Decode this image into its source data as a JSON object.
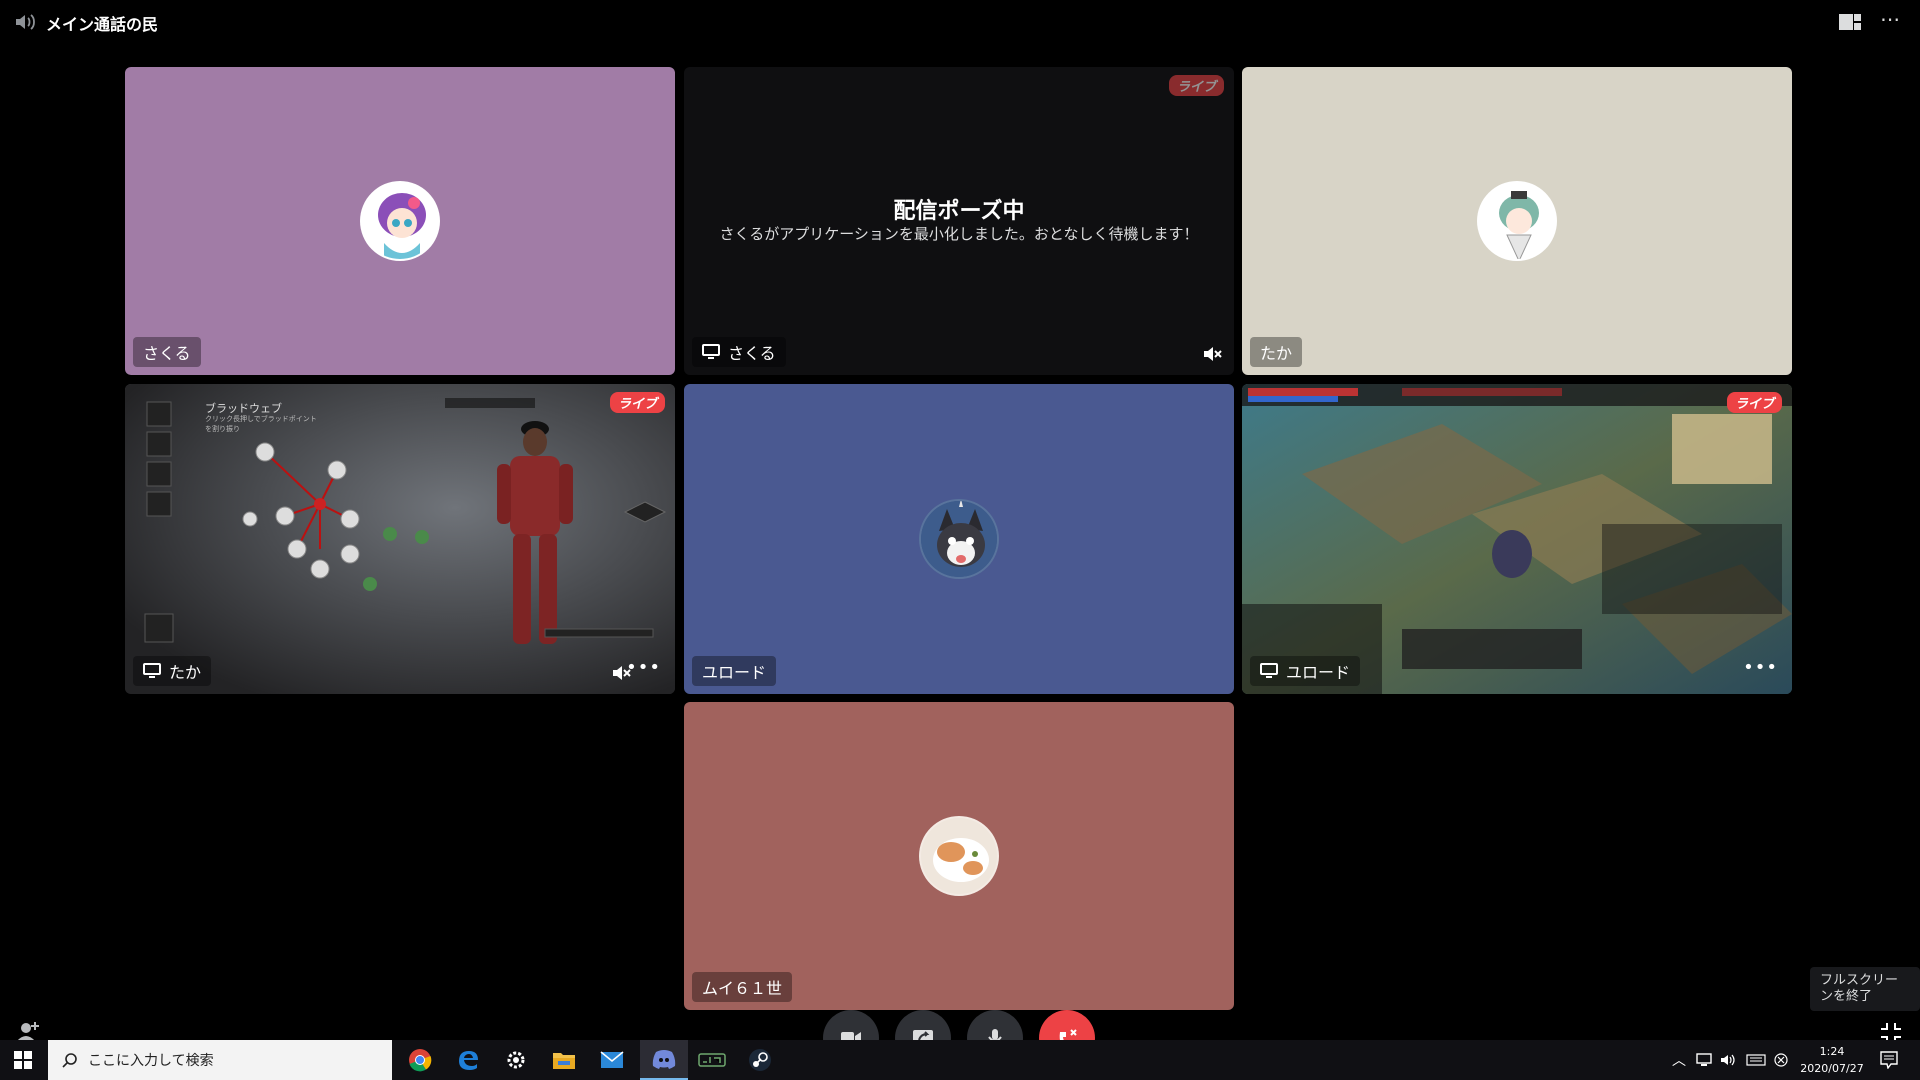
{
  "window": {
    "title": "メイン通話の民"
  },
  "tiles": {
    "t1": {
      "name": "さくる",
      "bg": "#a17ca6"
    },
    "t2": {
      "name": "さくる",
      "live": "ライブ",
      "pause_title": "配信ポーズ中",
      "pause_msg": "さくるがアプリケーションを最小化しました。おとなしく待機します！",
      "bg": "#0f0f11"
    },
    "t3": {
      "name": "たか",
      "bg": "#d8d4c7"
    },
    "t4": {
      "name": "たか",
      "live": "ライブ",
      "game_title": "ブラッドウェブ",
      "game_sub": "クリック長押しでブラッドポイント",
      "game_sub2": "を割り振り"
    },
    "t5": {
      "name": "ユロード",
      "bg": "#4a5991"
    },
    "t6": {
      "name": "ユロード",
      "live": "ライブ"
    },
    "t7": {
      "name": "ムイ６１世",
      "bg": "#a1625d"
    }
  },
  "tooltip": {
    "text": "フルスクリーンを終了"
  },
  "taskbar": {
    "search_placeholder": "ここに入力して検索",
    "time": "1:24",
    "date": "2020/07/27"
  },
  "colors": {
    "live_red": "#ed4245",
    "end_call_red": "#ed4245"
  }
}
